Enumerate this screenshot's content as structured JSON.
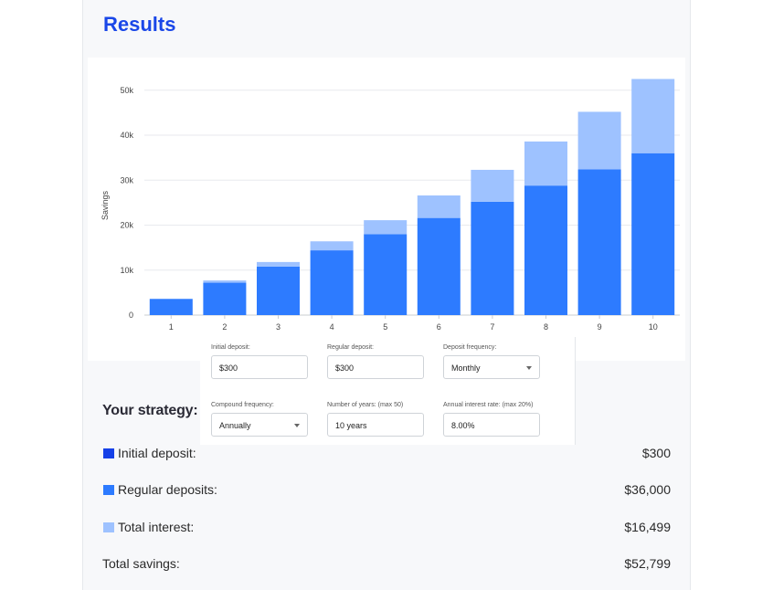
{
  "title": "Results",
  "colors": {
    "title": "#1a47e8",
    "initial": "#1641e8",
    "regular": "#2d7bff",
    "interest": "#9ec2ff"
  },
  "chart_data": {
    "type": "bar",
    "stacked": true,
    "categories": [
      "1",
      "2",
      "3",
      "4",
      "5",
      "6",
      "7",
      "8",
      "9",
      "10"
    ],
    "series": [
      {
        "name": "Regular deposits",
        "values": [
          3600,
          7200,
          10800,
          14400,
          18000,
          21600,
          25200,
          28800,
          32400,
          36000
        ]
      },
      {
        "name": "Total interest",
        "values": [
          0,
          500,
          1000,
          2000,
          3100,
          5000,
          7100,
          9800,
          12800,
          16499
        ]
      }
    ],
    "ylabel": "Savings",
    "xlabel": "",
    "ylim": [
      0,
      52799
    ],
    "yticks": [
      "0",
      "10k",
      "20k",
      "30k",
      "40k",
      "50k"
    ],
    "ytick_values": [
      0,
      10000,
      20000,
      30000,
      40000,
      50000
    ],
    "grid": true
  },
  "form": {
    "initial_deposit": {
      "label": "Initial deposit:",
      "value": "$300"
    },
    "regular_deposit": {
      "label": "Regular deposit:",
      "value": "$300"
    },
    "deposit_frequency": {
      "label": "Deposit frequency:",
      "value": "Monthly"
    },
    "compound_frequency": {
      "label": "Compound frequency:",
      "value": "Annually"
    },
    "years": {
      "label": "Number of years: (max 50)",
      "value": "10 years"
    },
    "rate": {
      "label": "Annual interest rate: (max 20%)",
      "value": "8.00%"
    }
  },
  "strategy": {
    "heading": "Your strategy:",
    "initial": {
      "label": "Initial deposit:",
      "value": "$300"
    },
    "regular": {
      "label": "Regular deposits:",
      "value": "$36,000"
    },
    "interest": {
      "label": "Total interest:",
      "value": "$16,499"
    },
    "total": {
      "label": "Total savings:",
      "value": "$52,799"
    }
  }
}
